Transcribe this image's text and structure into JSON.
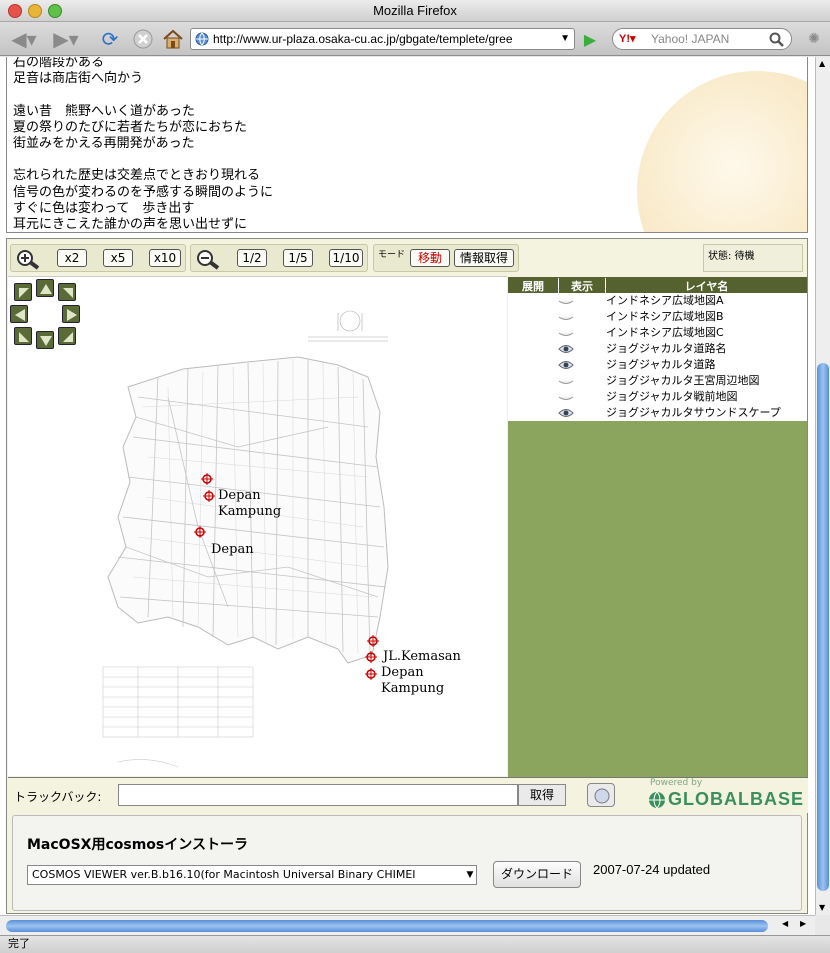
{
  "window": {
    "title": "Mozilla Firefox"
  },
  "toolbar": {
    "url": "http://www.ur-plaza.osaka-cu.ac.jp/gbgate/templete/gree",
    "search_placeholder": "Yahoo! JAPAN"
  },
  "poem": {
    "lines": [
      "石の階段がある",
      "足音は商店街へ向かう",
      "",
      "遠い昔　熊野へいく道があった",
      "夏の祭りのたびに若者たちが恋におちた",
      "街並みをかえる再開発があった",
      "",
      "忘れられた歴史は交差点でときおり現れる",
      "信号の色が変わるのを予感する瞬間のように",
      "すぐに色は変わって　歩き出す",
      "耳元にきこえた誰かの声を思い出せずに"
    ]
  },
  "viewer": {
    "zoom_in": [
      "x2",
      "x5",
      "x10"
    ],
    "zoom_out": [
      "1/2",
      "1/5",
      "1/10"
    ],
    "mode_label": "モード",
    "mode_move": "移動",
    "info_button": "情報取得",
    "status": "状態: 待機"
  },
  "map_labels": [
    "Depan Kampung",
    "Depan",
    "JL.Kemasan",
    "Depan Kampung"
  ],
  "layers": {
    "headers": [
      "展開",
      "表示",
      "レイヤ名"
    ],
    "rows": [
      {
        "name": "インドネシア広域地図A",
        "visible": false
      },
      {
        "name": "インドネシア広域地図B",
        "visible": false
      },
      {
        "name": "インドネシア広域地図C",
        "visible": false
      },
      {
        "name": "ジョグジャカルタ道路名",
        "visible": true
      },
      {
        "name": "ジョグジャカルタ道路",
        "visible": true
      },
      {
        "name": "ジョグジャカルタ王宮周辺地図",
        "visible": false
      },
      {
        "name": "ジョグジャカルタ戦前地図",
        "visible": false
      },
      {
        "name": "ジョグジャカルタサウンドスケープ",
        "visible": true
      }
    ]
  },
  "trackback": {
    "label": "トラックバック:",
    "value": "",
    "get_button": "取得"
  },
  "logo": {
    "powered": "Powered by",
    "name": "GLOBALBASE"
  },
  "installer": {
    "title": "MacOSX用cosmosインストーラ",
    "selected": "COSMOS VIEWER ver.B.b16.10(for Macintosh Universal Binary CHIMEI",
    "download_button": "ダウンロード",
    "updated": "2007-07-24 updated"
  },
  "status_bar": {
    "text": "完了"
  },
  "colors": {
    "accent": "#5b6b38",
    "layer_bg": "#8ba55f",
    "layer_header": "#55612f",
    "mode_red": "#cc0000"
  }
}
